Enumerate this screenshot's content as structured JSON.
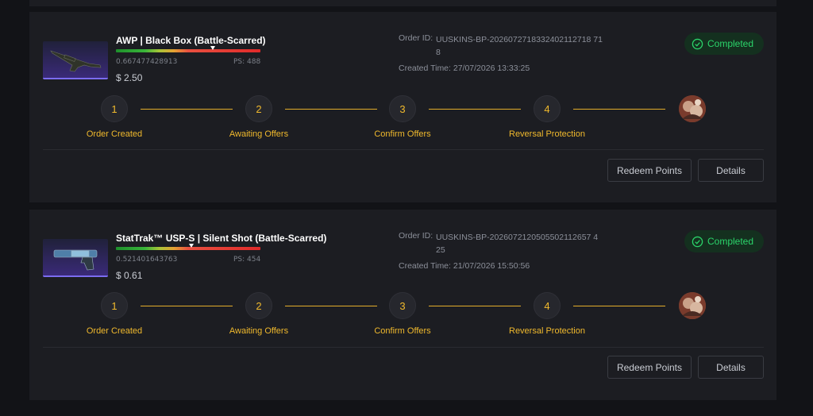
{
  "orders": [
    {
      "item_name": "AWP | Black Box (Battle-Scarred)",
      "float_value": "0.667477428913",
      "ps": "PS: 488",
      "wear_fraction": 0.67,
      "price": "$ 2.50",
      "order_id_label": "Order ID:",
      "order_id_line1": "UUSKINS-BP-2026072718332402112718 71",
      "order_id_line2": "8",
      "created_time": "Created Time: 27/07/2026 13:33:25",
      "status": "Completed",
      "steps": [
        {
          "number": "1",
          "label": "Order Created"
        },
        {
          "number": "2",
          "label": "Awaiting Offers"
        },
        {
          "number": "3",
          "label": "Confirm Offers"
        },
        {
          "number": "4",
          "label": "Reversal Protection"
        }
      ],
      "redeem_label": "Redeem Points",
      "details_label": "Details",
      "thumb_icon": "awp-rifle-icon"
    },
    {
      "item_name": "StatTrak™ USP-S | Silent Shot (Battle-Scarred)",
      "float_value": "0.521401643763",
      "ps": "PS: 454",
      "wear_fraction": 0.52,
      "price": "$ 0.61",
      "order_id_label": "Order ID:",
      "order_id_line1": "UUSKINS-BP-2026072120505502112657 4",
      "order_id_line2": "25",
      "created_time": "Created Time: 21/07/2026 15:50:56",
      "status": "Completed",
      "steps": [
        {
          "number": "1",
          "label": "Order Created"
        },
        {
          "number": "2",
          "label": "Awaiting Offers"
        },
        {
          "number": "3",
          "label": "Confirm Offers"
        },
        {
          "number": "4",
          "label": "Reversal Protection"
        }
      ],
      "redeem_label": "Redeem Points",
      "details_label": "Details",
      "thumb_icon": "usp-pistol-icon"
    }
  ],
  "colors": {
    "accent": "#f0b92d",
    "success": "#2bd46a",
    "card_bg": "#1c1d22",
    "page_bg": "#121317"
  }
}
